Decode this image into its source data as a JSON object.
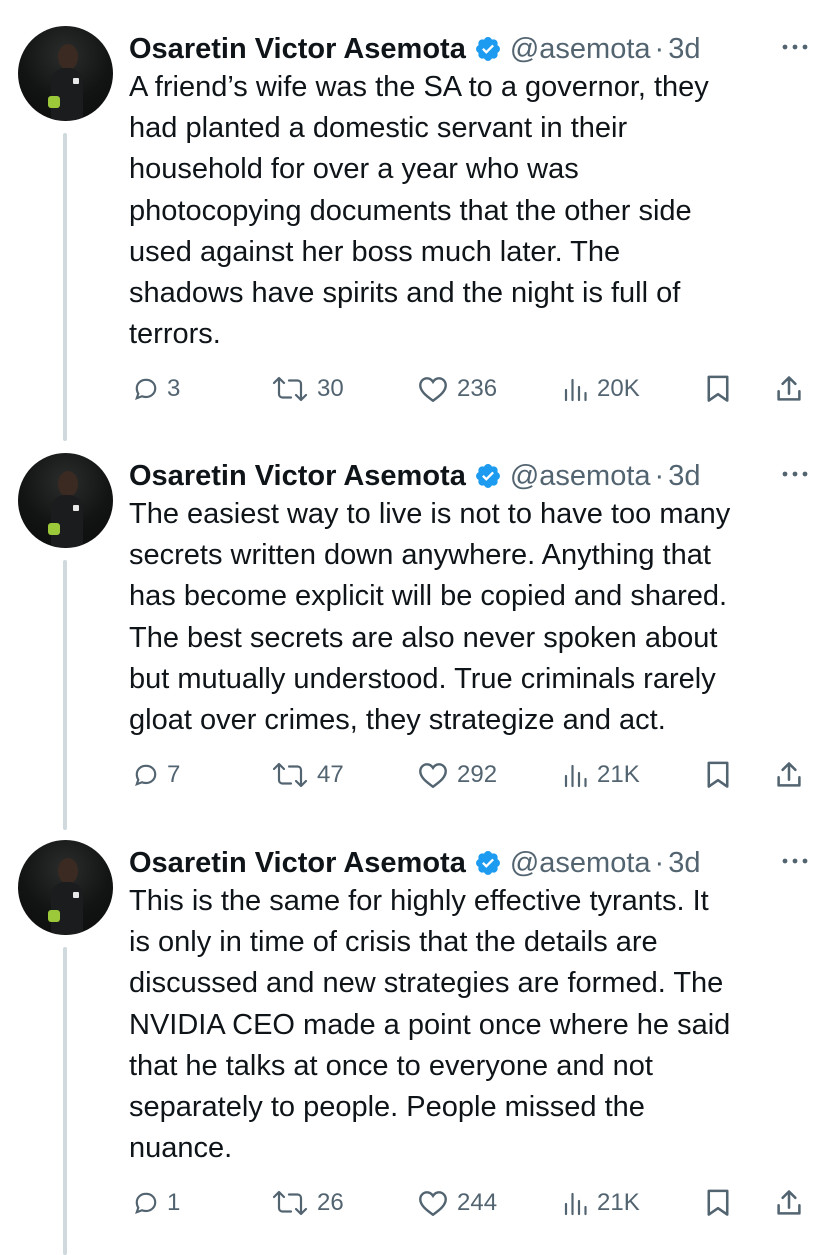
{
  "tweets": [
    {
      "author": "Osaretin Victor Asemota",
      "handle": "@asemota",
      "separator": "·",
      "time": "3d",
      "text": "A friend’s wife was the SA to a governor, they\nhad planted a domestic servant in their\nhousehold for over a year who was\nphotocopying documents that the other side\nused against her boss much later. The\nshadows have spirits and the night is full of\nterrors.",
      "replies": "3",
      "reposts": "30",
      "likes": "236",
      "views": "20K",
      "icons": {
        "verified": "verified-badge-icon",
        "more": "more-icon",
        "reply": "reply-icon",
        "repost": "repost-icon",
        "like": "like-icon",
        "views": "views-icon",
        "bookmark": "bookmark-icon",
        "share": "share-icon"
      }
    },
    {
      "author": "Osaretin Victor Asemota",
      "handle": "@asemota",
      "separator": "·",
      "time": "3d",
      "text": "The easiest way to live is not to have too many\nsecrets written down anywhere. Anything that\nhas become explicit will be copied and shared.\nThe best secrets are also never spoken about\nbut mutually understood. True criminals rarely\ngloat over crimes, they strategize and act.",
      "replies": "7",
      "reposts": "47",
      "likes": "292",
      "views": "21K"
    },
    {
      "author": "Osaretin Victor Asemota",
      "handle": "@asemota",
      "separator": "·",
      "time": "3d",
      "text": "This is the same for highly effective tyrants. It\nis only in time of crisis that the details are\ndiscussed and new strategies are formed. The\nNVIDIA CEO made a point once where he said\nthat he talks at once to everyone and not\nseparately to people. People missed the\nnuance.",
      "replies": "1",
      "reposts": "26",
      "likes": "244",
      "views": "21K"
    }
  ],
  "colors": {
    "text": "#0f1419",
    "secondary": "#536471",
    "verified": "#1d9bf0",
    "thread_line": "#cfd9de"
  }
}
